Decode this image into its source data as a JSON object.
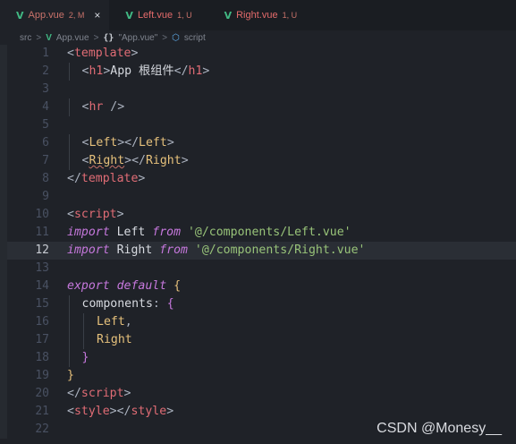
{
  "tabs": [
    {
      "icon": "vue-file-icon",
      "vlabel": "V",
      "name": "App.vue",
      "status": "2, M",
      "close": "×"
    },
    {
      "icon": "vue-file-icon",
      "vlabel": "V",
      "name": "Left.vue",
      "status": "1, U"
    },
    {
      "icon": "vue-file-icon",
      "vlabel": "V",
      "name": "Right.vue",
      "status": "1, U"
    }
  ],
  "breadcrumb": {
    "folder": "src",
    "sep": ">",
    "vlabel": "V",
    "file": "App.vue",
    "braces": "{}",
    "component": "\"App.vue\"",
    "cube": "⬡",
    "section": "script"
  },
  "lines": [
    {
      "n": "1",
      "parts": [
        {
          "t": "<",
          "c": "punc"
        },
        {
          "t": "template",
          "c": "tag"
        },
        {
          "t": ">",
          "c": "punc"
        }
      ]
    },
    {
      "n": "2",
      "indent": 1,
      "parts": [
        {
          "t": "<",
          "c": "punc"
        },
        {
          "t": "h1",
          "c": "tag"
        },
        {
          "t": ">",
          "c": "punc"
        },
        {
          "t": "App 根组件",
          "c": "plain"
        },
        {
          "t": "</",
          "c": "punc"
        },
        {
          "t": "h1",
          "c": "tag"
        },
        {
          "t": ">",
          "c": "punc"
        }
      ]
    },
    {
      "n": "3",
      "parts": []
    },
    {
      "n": "4",
      "indent": 1,
      "parts": [
        {
          "t": "<",
          "c": "punc"
        },
        {
          "t": "hr",
          "c": "tag"
        },
        {
          "t": " />",
          "c": "punc"
        }
      ]
    },
    {
      "n": "5",
      "parts": []
    },
    {
      "n": "6",
      "indent": 1,
      "parts": [
        {
          "t": "<",
          "c": "punc"
        },
        {
          "t": "Left",
          "c": "var"
        },
        {
          "t": "></",
          "c": "punc"
        },
        {
          "t": "Left",
          "c": "var"
        },
        {
          "t": ">",
          "c": "punc"
        }
      ]
    },
    {
      "n": "7",
      "indent": 1,
      "parts": [
        {
          "t": "<",
          "c": "punc"
        },
        {
          "t": "Right",
          "c": "var squiggle"
        },
        {
          "t": "></",
          "c": "punc"
        },
        {
          "t": "Right",
          "c": "var"
        },
        {
          "t": ">",
          "c": "punc"
        }
      ]
    },
    {
      "n": "8",
      "parts": [
        {
          "t": "</",
          "c": "punc"
        },
        {
          "t": "template",
          "c": "tag"
        },
        {
          "t": ">",
          "c": "punc"
        }
      ]
    },
    {
      "n": "9",
      "parts": []
    },
    {
      "n": "10",
      "parts": [
        {
          "t": "<",
          "c": "punc"
        },
        {
          "t": "script",
          "c": "tag"
        },
        {
          "t": ">",
          "c": "punc"
        }
      ]
    },
    {
      "n": "11",
      "parts": [
        {
          "t": "import",
          "c": "kw"
        },
        {
          "t": " Left ",
          "c": "plain"
        },
        {
          "t": "from",
          "c": "kw"
        },
        {
          "t": " '@/components/Left.vue'",
          "c": "str"
        }
      ]
    },
    {
      "n": "12",
      "current": true,
      "parts": [
        {
          "t": "import",
          "c": "kw"
        },
        {
          "t": " Right ",
          "c": "plain"
        },
        {
          "t": "from",
          "c": "kw"
        },
        {
          "t": " '@/components/Right.vue'",
          "c": "str"
        }
      ]
    },
    {
      "n": "13",
      "parts": []
    },
    {
      "n": "14",
      "parts": [
        {
          "t": "export",
          "c": "kw"
        },
        {
          "t": " ",
          "c": "plain"
        },
        {
          "t": "default",
          "c": "kw"
        },
        {
          "t": " ",
          "c": "plain"
        },
        {
          "t": "{",
          "c": "brace-y"
        }
      ]
    },
    {
      "n": "15",
      "indent": 1,
      "parts": [
        {
          "t": "components",
          "c": "plain"
        },
        {
          "t": ": ",
          "c": "punc"
        },
        {
          "t": "{",
          "c": "brace-p"
        }
      ]
    },
    {
      "n": "16",
      "indent": 2,
      "parts": [
        {
          "t": "Left",
          "c": "var"
        },
        {
          "t": ",",
          "c": "punc"
        }
      ]
    },
    {
      "n": "17",
      "indent": 2,
      "parts": [
        {
          "t": "Right",
          "c": "var"
        }
      ]
    },
    {
      "n": "18",
      "indent": 1,
      "parts": [
        {
          "t": "}",
          "c": "brace-p"
        }
      ]
    },
    {
      "n": "19",
      "parts": [
        {
          "t": "}",
          "c": "brace-y"
        }
      ]
    },
    {
      "n": "20",
      "parts": [
        {
          "t": "</",
          "c": "punc"
        },
        {
          "t": "script",
          "c": "tag"
        },
        {
          "t": ">",
          "c": "punc"
        }
      ]
    },
    {
      "n": "21",
      "parts": [
        {
          "t": "<",
          "c": "punc"
        },
        {
          "t": "style",
          "c": "tag"
        },
        {
          "t": "></",
          "c": "punc"
        },
        {
          "t": "style",
          "c": "tag"
        },
        {
          "t": ">",
          "c": "punc"
        }
      ]
    },
    {
      "n": "22",
      "parts": []
    }
  ],
  "watermark": "CSDN @Monesy__"
}
